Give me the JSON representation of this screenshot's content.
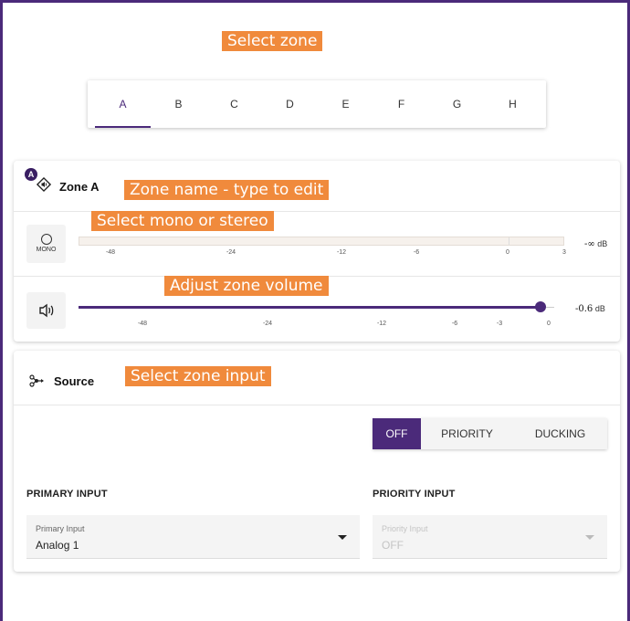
{
  "annotations": {
    "select_zone": "Select zone",
    "zone_name": "Zone name - type to edit",
    "mono_stereo": "Select mono or stereo",
    "adjust_volume": "Adjust zone volume",
    "select_input": "Select zone input"
  },
  "tabs": [
    {
      "label": "A",
      "active": true
    },
    {
      "label": "B"
    },
    {
      "label": "C"
    },
    {
      "label": "D"
    },
    {
      "label": "E"
    },
    {
      "label": "F"
    },
    {
      "label": "G"
    },
    {
      "label": "H"
    }
  ],
  "zone": {
    "badge": "A",
    "title": "Zone A",
    "mono_label": "MONO",
    "meter_ticks": [
      "-48",
      "-24",
      "-12",
      "-6",
      "0",
      "3"
    ],
    "meter_readout_value": "-∞",
    "meter_readout_unit": "dB",
    "volume_ticks": [
      "-48",
      "-24",
      "-12",
      "-6",
      "-3",
      "0"
    ],
    "volume_readout_value": "-0.6",
    "volume_readout_unit": "dB",
    "volume_db": -0.6
  },
  "source": {
    "title": "Source",
    "modes": [
      "OFF",
      "PRIORITY",
      "DUCKING"
    ],
    "selected_mode": "OFF",
    "primary_section": "PRIMARY INPUT",
    "primary_field_label": "Primary Input",
    "primary_value": "Analog 1",
    "priority_section": "PRIORITY INPUT",
    "priority_field_label": "Priority Input",
    "priority_value": "OFF"
  },
  "colors": {
    "accent": "#4b2a7a",
    "annotation": "#f08a3c"
  }
}
